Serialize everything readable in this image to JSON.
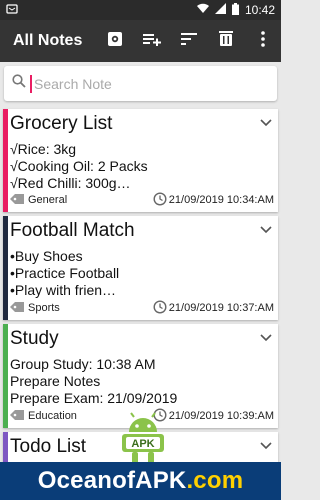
{
  "status": {
    "time": "10:42"
  },
  "appbar": {
    "title": "All Notes",
    "icons": [
      "settings-icon",
      "add-note-icon",
      "sort-icon",
      "delete-icon",
      "more-icon"
    ]
  },
  "search": {
    "placeholder": "Search Note",
    "value": ""
  },
  "notes": [
    {
      "title": "Grocery List",
      "lines": [
        "√Rice: 3kg",
        "√Cooking Oil: 2 Packs",
        "√Red Chilli: 300g…"
      ],
      "category": "General",
      "timestamp": "21/09/2019 10:34:AM",
      "color": "#e91e63"
    },
    {
      "title": "Football Match",
      "lines": [
        "•Buy Shoes",
        "•Practice Football",
        "•Play with frien…"
      ],
      "category": "Sports",
      "timestamp": "21/09/2019 10:37:AM",
      "color": "#212a3f"
    },
    {
      "title": "Study",
      "lines": [
        "Group Study: 10:38 AM",
        "Prepare Notes",
        "Prepare Exam: 21/09/2019"
      ],
      "category": "Education",
      "timestamp": "21/09/2019 10:39:AM",
      "color": "#4caf50"
    },
    {
      "title": "Todo List",
      "lines": [],
      "category": "",
      "timestamp": "",
      "color": "#7e57c2"
    }
  ],
  "watermark": {
    "text_a": "OceanofAPK",
    "text_b": ".com"
  },
  "logo_text": "APK"
}
